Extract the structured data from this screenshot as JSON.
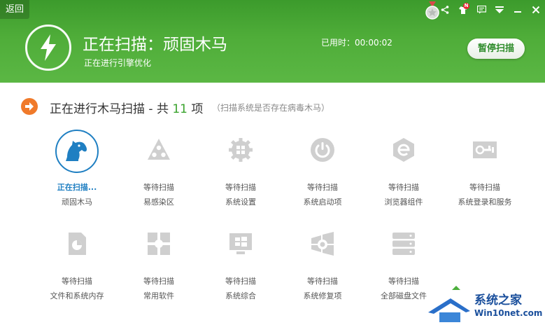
{
  "header": {
    "back_label": "返回",
    "title": "正在扫描：顽固木马",
    "subtitle": "正在进行引擎优化",
    "elapsed": "已用时：00:00:02",
    "pause_label": "暂停扫描",
    "notification_badge": "N"
  },
  "section": {
    "title_prefix": "正在进行木马扫描 - 共",
    "count": "11",
    "title_suffix": "项",
    "note": "（扫描系统是否存在病毒木马）"
  },
  "items": [
    {
      "status": "正在扫描...",
      "name": "顽固木马",
      "icon": "trojan-horse-icon",
      "active": true
    },
    {
      "status": "等待扫描",
      "name": "易感染区",
      "icon": "infection-zone-icon"
    },
    {
      "status": "等待扫描",
      "name": "系统设置",
      "icon": "system-settings-icon"
    },
    {
      "status": "等待扫描",
      "name": "系统启动项",
      "icon": "power-icon"
    },
    {
      "status": "等待扫描",
      "name": "浏览器组件",
      "icon": "browser-icon"
    },
    {
      "status": "等待扫描",
      "name": "系统登录和服务",
      "icon": "login-service-icon"
    },
    {
      "status": "等待扫描",
      "name": "文件和系统内存",
      "icon": "memory-icon"
    },
    {
      "status": "等待扫描",
      "name": "常用软件",
      "icon": "software-icon"
    },
    {
      "status": "等待扫描",
      "name": "系统综合",
      "icon": "windows-icon"
    },
    {
      "status": "等待扫描",
      "name": "系统修复项",
      "icon": "repair-icon"
    },
    {
      "status": "等待扫描",
      "name": "全部磁盘文件",
      "icon": "disk-icon"
    }
  ],
  "watermark": {
    "line1": "系统之家",
    "line2": "Win10net.com"
  },
  "colors": {
    "header_green": "#4fad39",
    "active_blue": "#1f7fc2",
    "count_green": "#3aa32d",
    "section_orange": "#f07a2a",
    "inactive_icon": "#cfcfcf"
  }
}
